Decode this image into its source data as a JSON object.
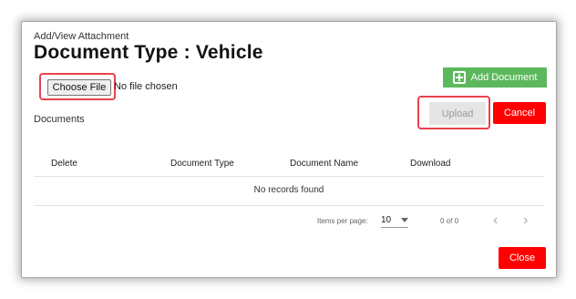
{
  "dialog": {
    "subtitle": "Add/View Attachment",
    "title": "Document Type : Vehicle"
  },
  "file_input": {
    "button_label": "Choose File",
    "status": "No file chosen"
  },
  "actions": {
    "add_document": "Add Document",
    "upload": "Upload",
    "cancel": "Cancel",
    "close": "Close"
  },
  "documents": {
    "label": "Documents",
    "columns": [
      "Delete",
      "Document Type",
      "Document Name",
      "Download"
    ],
    "empty_message": "No records found"
  },
  "paginator": {
    "items_per_page_label": "Items per page:",
    "page_size": "10",
    "range": "0 of 0"
  },
  "colors": {
    "danger": "#ff0000",
    "success": "#5cb85c",
    "highlight": "#e8434e",
    "disabled": "#e5e5e5"
  }
}
